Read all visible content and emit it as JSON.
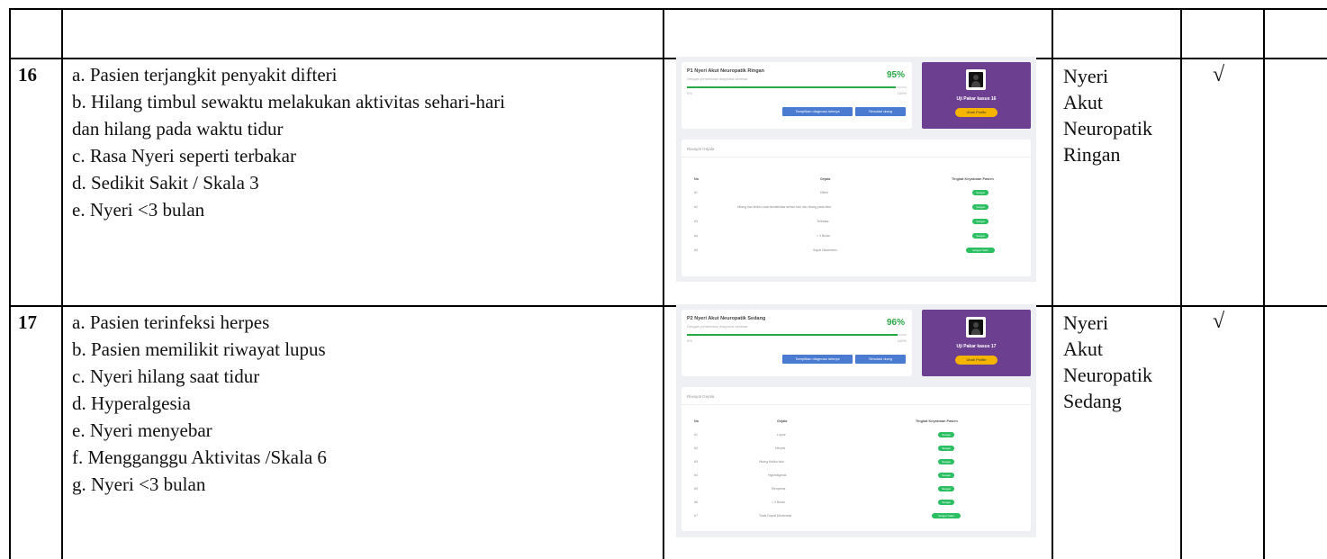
{
  "rows": [
    {
      "no": "16",
      "criteria": [
        "a. Pasien terjangkit penyakit difteri",
        "b. Hilang timbul sewaktu melakukan aktivitas sehari-hari",
        "dan hilang pada waktu tidur",
        "c. Rasa Nyeri seperti terbakar",
        "d. Sedikit Sakit / Skala 3",
        "e. Nyeri <3 bulan"
      ],
      "diagnosis": [
        "Nyeri",
        "Akut",
        "Neuropatik",
        "Ringan"
      ],
      "check": "√",
      "screenshot": {
        "result_title": "P1 Nyeri Akut Neuropatik Ringan",
        "result_subtitle": "Dengan persentase diagnosa sebesar",
        "percent_label": "95%",
        "progress": 0.95,
        "bar_min": "0%",
        "bar_max": "100%",
        "button_1": "Tampilkan diagnosa lainnya",
        "button_2": "Simulasi ulang",
        "profile_name": "Uji Pakar kasus 16",
        "profile_button": "Ubah Profile",
        "history_title": "Riwayat Gejala",
        "history_headers": [
          "No",
          "Gejala",
          "Tingkat Keyakinan Pasien"
        ],
        "history_rows": [
          {
            "no": "#1",
            "symptom": "Difteri",
            "badge": "Sangat"
          },
          {
            "no": "#2",
            "symptom": "Hilang dan timbul saat beraktivitas sehari-hari dan hilang pada tidur",
            "badge": "Sangat"
          },
          {
            "no": "#3",
            "symptom": "Terbakar",
            "badge": "Sangat"
          },
          {
            "no": "#4",
            "symptom": "< 3 Bulan",
            "badge": "Sangat"
          },
          {
            "no": "#5",
            "symptom": "Sapat Ditoleransi",
            "badge": "Sangat Yakin"
          }
        ]
      }
    },
    {
      "no": "17",
      "criteria": [
        "a. Pasien terinfeksi herpes",
        "b. Pasien memilikit riwayat lupus",
        "c. Nyeri hilang saat tidur",
        "d. Hyperalgesia",
        "e. Nyeri menyebar",
        "f. Mengganggu Aktivitas /Skala 6",
        "g. Nyeri <3 bulan"
      ],
      "diagnosis": [
        "Nyeri",
        "Akut",
        "Neuropatik",
        "Sedang"
      ],
      "check": "√",
      "screenshot": {
        "result_title": "P2 Nyeri Akut Neuropatik Sedang",
        "result_subtitle": "Dengan persentase diagnosa sebesar",
        "percent_label": "96%",
        "progress": 0.96,
        "bar_min": "0%",
        "bar_max": "100%",
        "button_1": "Tampilkan diagnosa lainnya",
        "button_2": "Simulasi ulang",
        "profile_name": "Uji Pakar kasus 17",
        "profile_button": "Ubah Profile",
        "history_title": "Riwayat Gejala",
        "history_headers": [
          "No",
          "Gejala",
          "Tingkat Keyakinan Pasien"
        ],
        "history_rows": [
          {
            "no": "#1",
            "symptom": "Lupus",
            "badge": "Sangat"
          },
          {
            "no": "#2",
            "symptom": "Herpes",
            "badge": "Sangat"
          },
          {
            "no": "#3",
            "symptom": "Hilang Ketika tidur",
            "badge": "Sangat"
          },
          {
            "no": "#4",
            "symptom": "Hyperalgesia",
            "badge": "Sangat"
          },
          {
            "no": "#5",
            "symptom": "Menyebar",
            "badge": "Sangat"
          },
          {
            "no": "#6",
            "symptom": "< 3 Bulan",
            "badge": "Sangat"
          },
          {
            "no": "#7",
            "symptom": "Tidak Dapat Ditoleransi",
            "badge": "Sangat Yakin"
          }
        ]
      }
    }
  ]
}
